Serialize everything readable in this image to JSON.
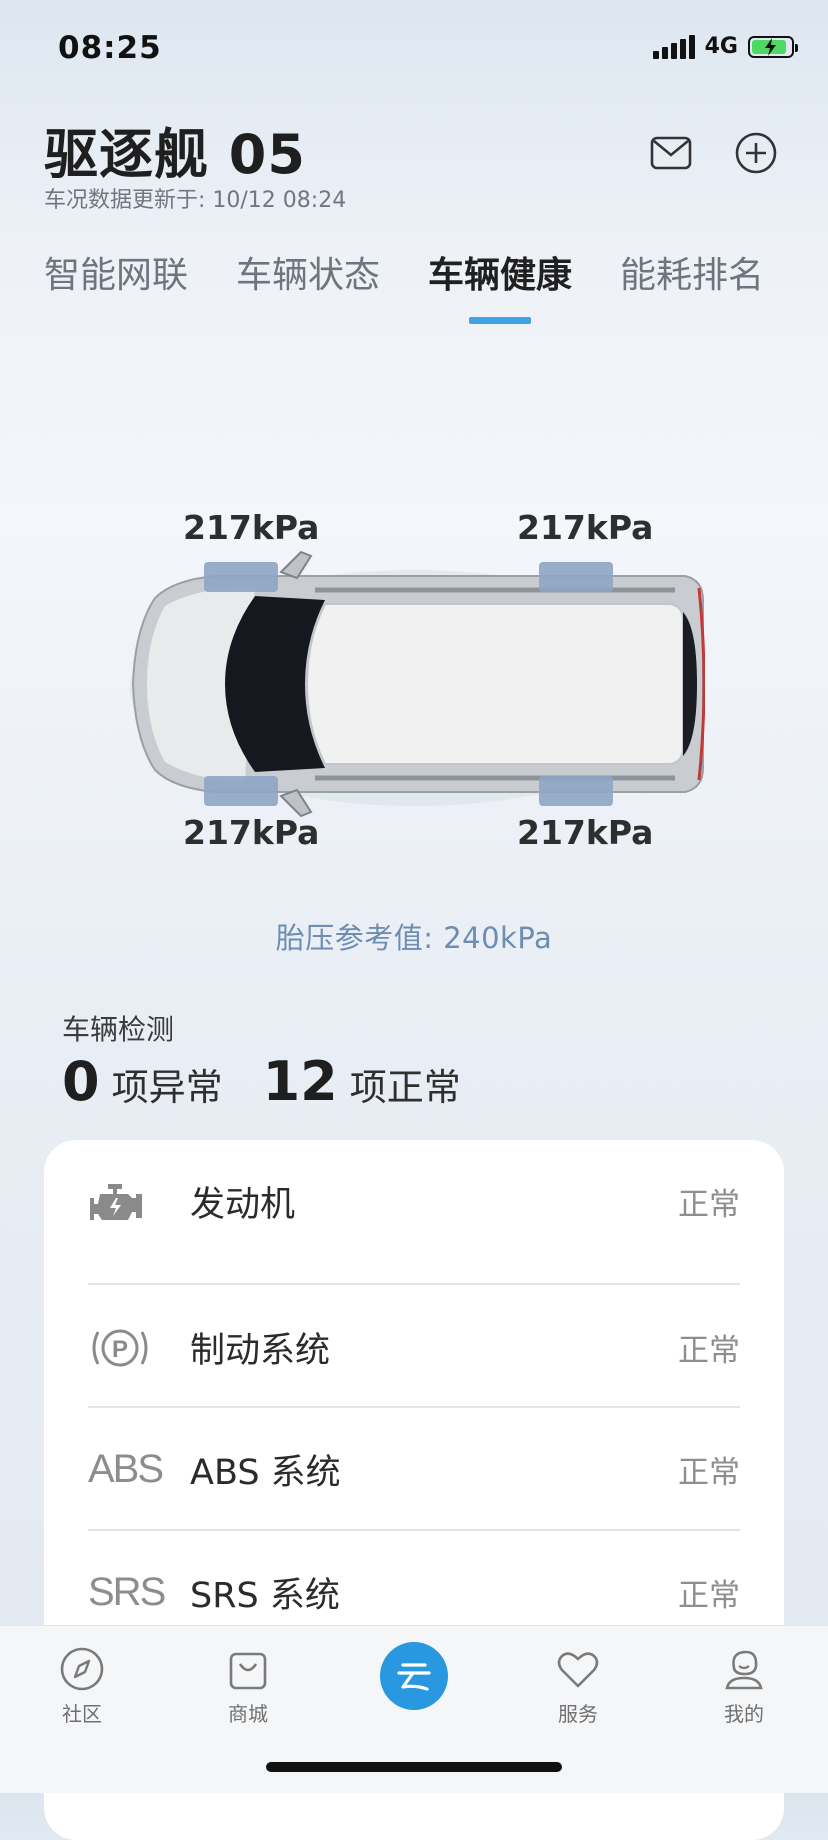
{
  "status_bar": {
    "time": "08:25",
    "network": "4G"
  },
  "header": {
    "title": "驱逐舰 05",
    "update_text": "车况数据更新于: 10/12 08:24"
  },
  "tabs": [
    {
      "label": "智能网联"
    },
    {
      "label": "车辆状态"
    },
    {
      "label": "车辆健康",
      "active": true
    },
    {
      "label": "能耗排名"
    }
  ],
  "tires": {
    "front_left": "217kPa",
    "rear_left": "217kPa",
    "front_right": "217kPa",
    "rear_right": "217kPa",
    "reference": "胎压参考值:  240kPa"
  },
  "detection": {
    "title": "车辆检测",
    "abnormal_count": "0",
    "abnormal_label": "项异常",
    "normal_count": "12",
    "normal_label": "项正常",
    "items": [
      {
        "icon": "engine-icon",
        "name": "发动机",
        "status": "正常"
      },
      {
        "icon": "parking-brake-icon",
        "name": "制动系统",
        "status": "正常"
      },
      {
        "icon": "abs-icon",
        "icon_text": "ABS",
        "name": "ABS 系统",
        "status": "正常"
      },
      {
        "icon": "srs-icon",
        "icon_text": "SRS",
        "name": "SRS 系统",
        "status": "正常"
      }
    ]
  },
  "nav": {
    "items": [
      {
        "label": "社区"
      },
      {
        "label": "商城"
      },
      {
        "label": ""
      },
      {
        "label": "服务"
      },
      {
        "label": "我的"
      }
    ]
  },
  "colors": {
    "accent": "#2a98e0",
    "tab_indicator": "#3ea4e6",
    "reference_text": "#6e8db0"
  }
}
